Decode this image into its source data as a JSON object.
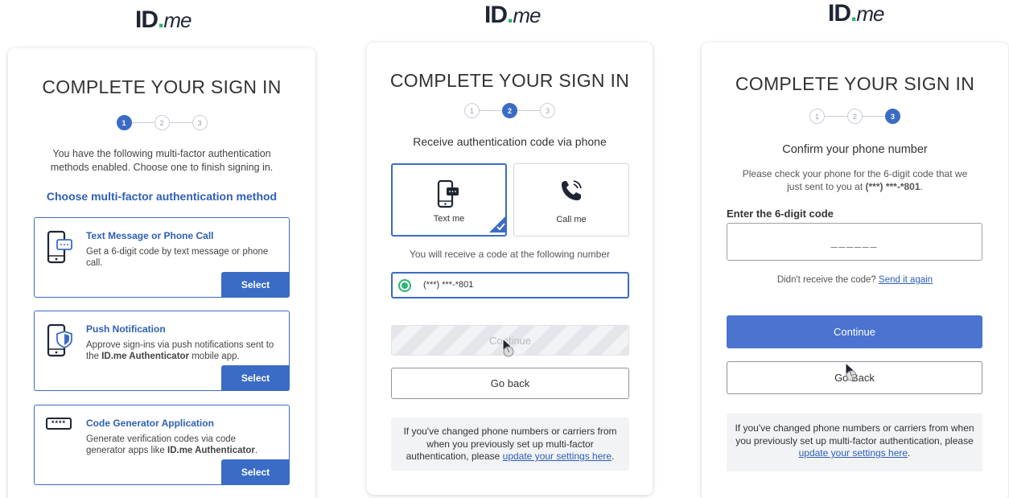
{
  "brand": {
    "logo_id": "ID",
    "logo_me": "me",
    "logo_dot": "."
  },
  "panel1": {
    "title": "COMPLETE YOUR SIGN IN",
    "steps": [
      "1",
      "2",
      "3"
    ],
    "intro": "You have the following multi-factor authentication methods enabled. Choose one to finish signing in.",
    "heading": "Choose multi-factor authentication method",
    "methods": [
      {
        "title": "Text Message or Phone Call",
        "desc": "Get a 6-digit code by text message or phone call.",
        "button": "Select"
      },
      {
        "title": "Push Notification",
        "desc_pre": "Approve sign-ins via push notifications sent to the ",
        "desc_bold": "ID.me Authenticator",
        "desc_post": " mobile app.",
        "button": "Select"
      },
      {
        "title": "Code Generator Application",
        "desc_pre": "Generate verification codes via code generator apps like ",
        "desc_bold": "ID.me Authenticator",
        "desc_post": ".",
        "button": "Select",
        "icon_text": "****"
      }
    ]
  },
  "panel2": {
    "title": "COMPLETE YOUR SIGN IN",
    "steps": [
      "1",
      "2",
      "3"
    ],
    "subtitle": "Receive authentication code via phone",
    "options": [
      {
        "label": "Text me"
      },
      {
        "label": "Call me"
      }
    ],
    "receive_text": "You will receive a code at the following number",
    "phone_number": "(***) ***-*801",
    "continue_label": "Continue",
    "goback_label": "Go back",
    "info_pre": "If you've changed phone numbers or carriers from when you previously set up multi-factor authentication, please ",
    "info_link": "update your settings here",
    "info_post": "."
  },
  "panel3": {
    "title": "COMPLETE YOUR SIGN IN",
    "steps": [
      "1",
      "2",
      "3"
    ],
    "subtitle": "Confirm your phone number",
    "desc_pre": "Please check your phone for the 6-digit code that we just sent to you at ",
    "desc_bold": "(***) ***-*801",
    "desc_post": ".",
    "code_label": "Enter the 6-digit code",
    "code_placeholder": "______",
    "resend_text": "Didn't receive the code?",
    "resend_link": "Send it again",
    "continue_label": "Continue",
    "goback_label": "Go Back",
    "info_pre": "If you've changed phone numbers or carriers from when you previously set up multi-factor authentication, please ",
    "info_link": "update your settings here",
    "info_post": "."
  },
  "colors": {
    "accent": "#3b6cc5",
    "brand_dot": "#2bb673",
    "info_bg": "#f2f3f5",
    "disabled": "#e9eaec"
  },
  "icons": [
    "phone-message-icon",
    "phone-shield-icon",
    "password-code-icon",
    "phone-call-icon",
    "checkmark-icon",
    "radio-selected-icon",
    "cursor-icon"
  ]
}
